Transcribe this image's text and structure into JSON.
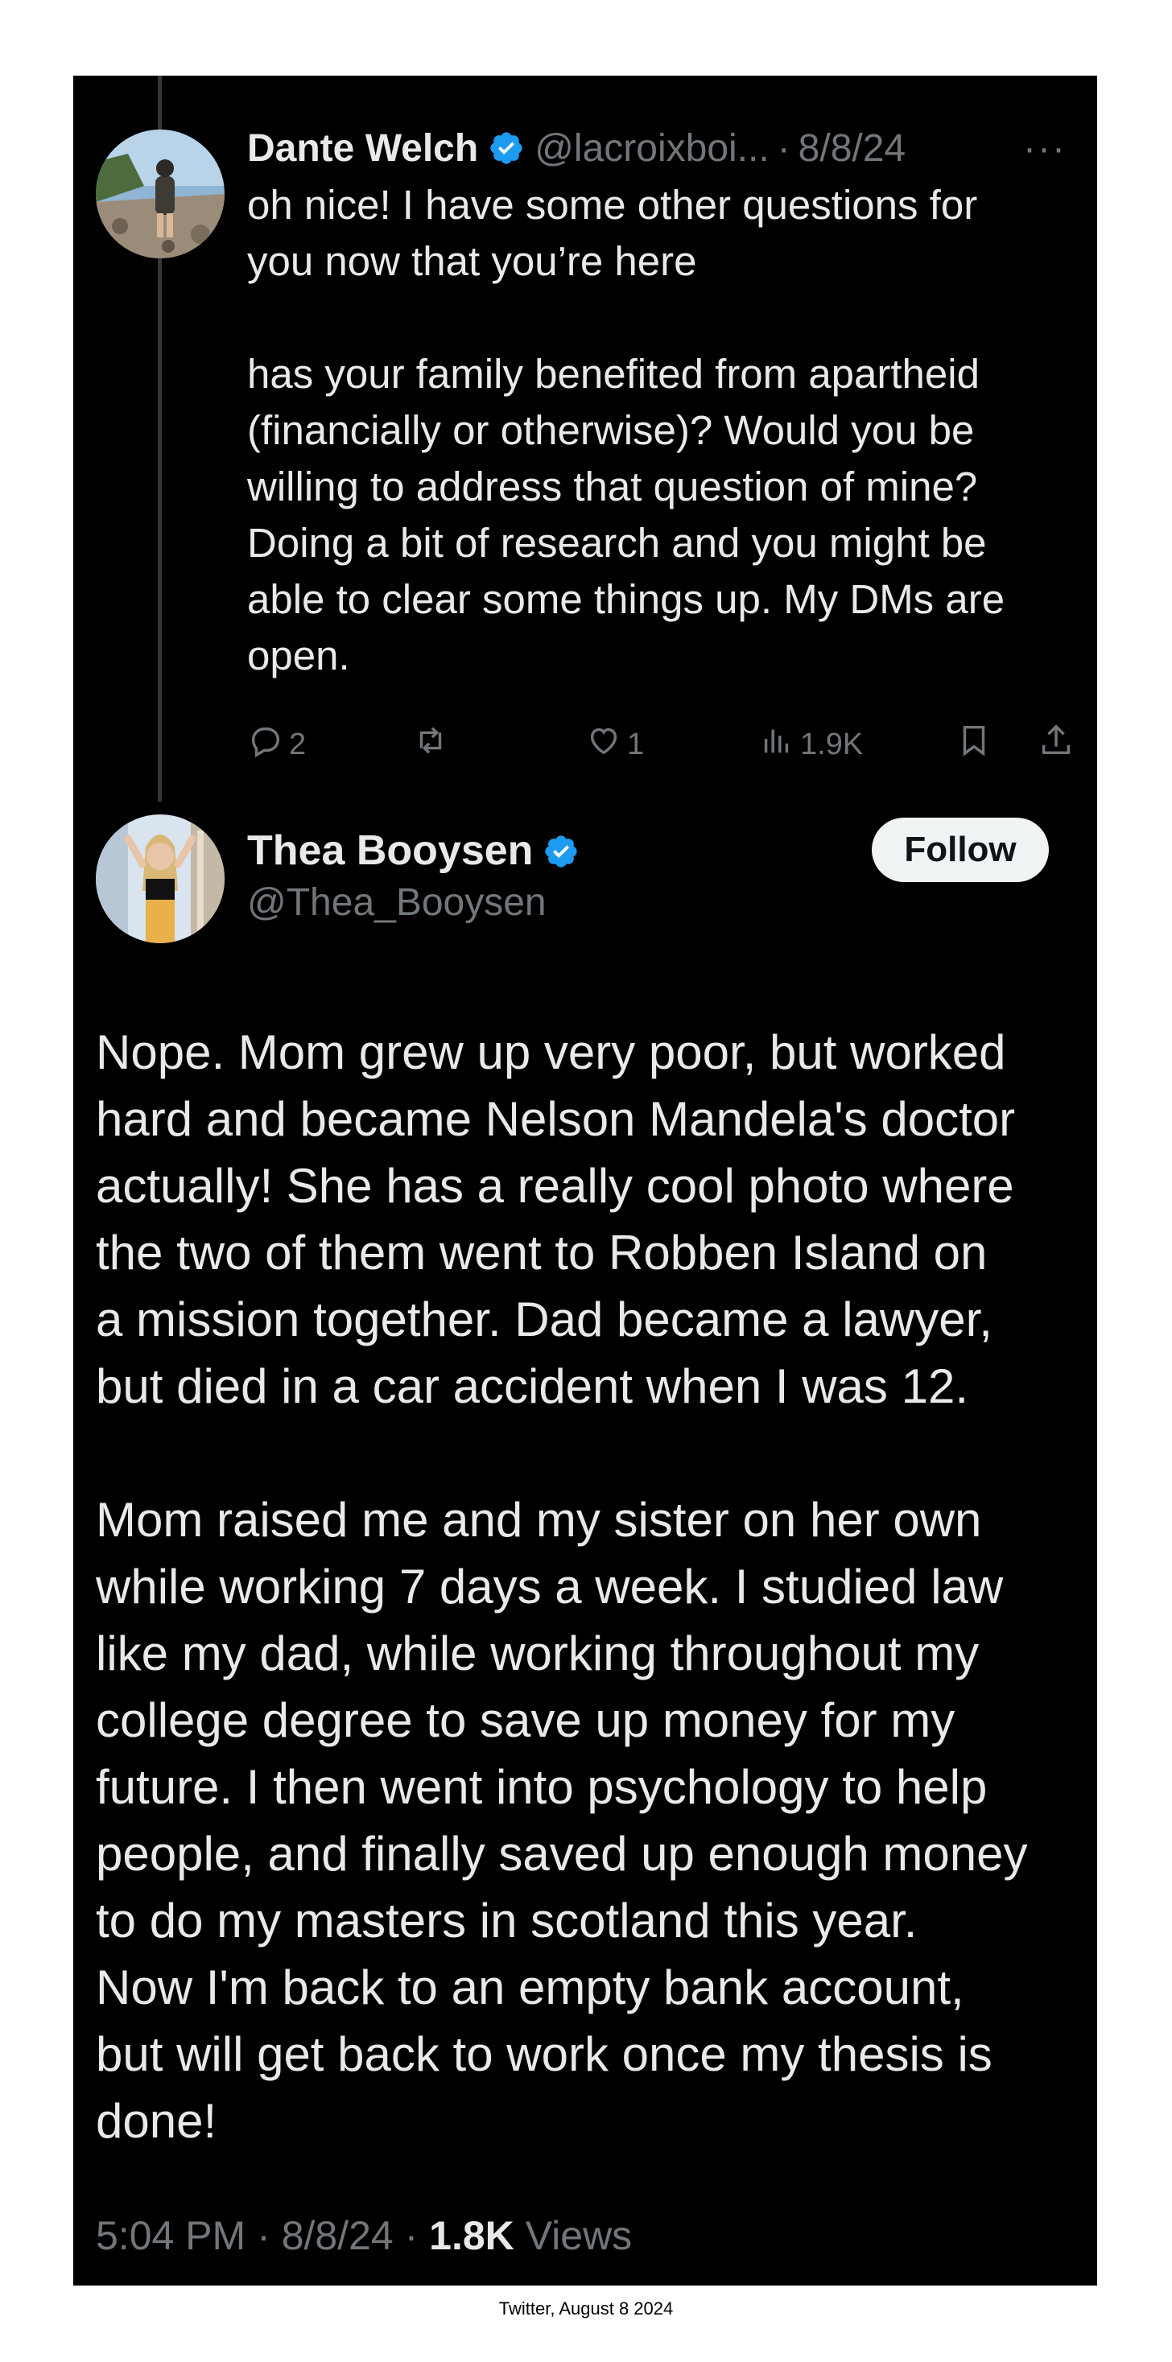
{
  "colors": {
    "background": "#000000",
    "text": "#e7e9ea",
    "muted": "#71767b",
    "verified": "#1d9bf0",
    "follow_bg": "#eff3f4"
  },
  "reply": {
    "author_name": "Dante Welch",
    "handle": "@lacroixboi...",
    "separator": "·",
    "date": "8/8/24",
    "more_label": "···",
    "text": "oh nice! I have some other questions for\nyou now that you’re here\n\nhas your family benefited from apartheid\n(financially or otherwise)? Would you be\nwilling to address that question of mine?\nDoing a bit of research and you might be\nable to clear some things up. My DMs are\nopen.",
    "actions": {
      "replies": "2",
      "reposts": "",
      "likes": "1",
      "views": "1.9K"
    },
    "icons": [
      "reply-icon",
      "repost-icon",
      "like-icon",
      "views-icon",
      "bookmark-icon",
      "share-icon"
    ]
  },
  "tweet": {
    "author_name": "Thea Booysen",
    "handle": "@Thea_Booysen",
    "follow_label": "Follow",
    "text": "Nope. Mom grew up very poor, but worked\nhard and became Nelson Mandela's doctor\nactually! She has a really cool photo where\nthe two of them went to Robben Island on\na mission together. Dad became a lawyer,\nbut died in a car accident when I was 12.\n\nMom raised me and my sister on her own\nwhile working 7 days a week. I studied law\nlike my dad, while working throughout my\ncollege degree to save up money for my\nfuture. I then went into psychology to help\npeople, and finally saved up enough money\nto do my masters in scotland this year.\nNow I'm back to an empty bank account,\nbut will get back to work once my thesis is\ndone!",
    "time": "5:04 PM",
    "separator": "·",
    "date": "8/8/24",
    "views_count": "1.8K",
    "views_label": "Views"
  },
  "caption": "Twitter, August 8 2024"
}
